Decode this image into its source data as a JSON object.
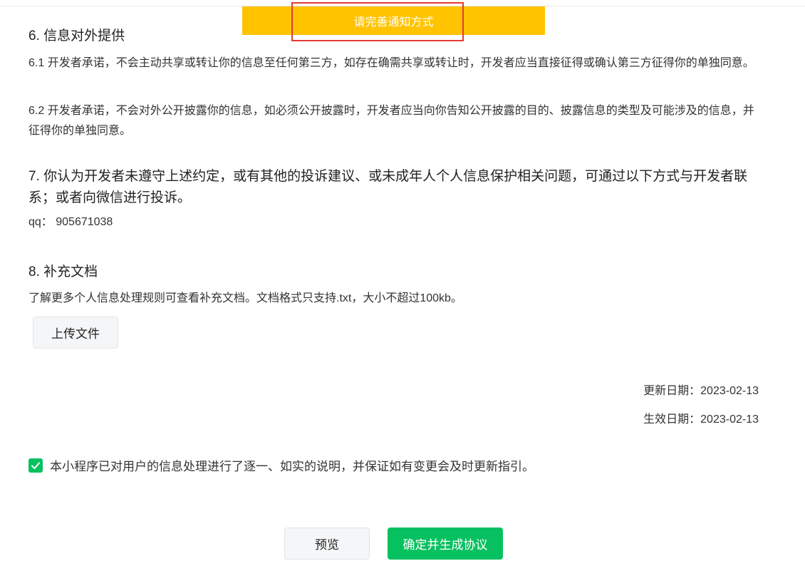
{
  "toast": {
    "text": "请完善通知方式"
  },
  "section6": {
    "title": "6.  信息对外提供",
    "p1": "6.1   开发者承诺，不会主动共享或转让你的信息至任何第三方，如存在确需共享或转让时，开发者应当直接征得或确认第三方征得你的单独同意。",
    "p2": "6.2   开发者承诺，不会对外公开披露你的信息，如必须公开披露时，开发者应当向你告知公开披露的目的、披露信息的类型及可能涉及的信息，并征得你的单独同意。"
  },
  "section7": {
    "title": "7.  你认为开发者未遵守上述约定，或有其他的投诉建议、或未成年人个人信息保护相关问题，可通过以下方式与开发者联系；或者向微信进行投诉。",
    "contact": "qq：  905671038"
  },
  "section8": {
    "title": "8.  补充文档",
    "desc": "了解更多个人信息处理规则可查看补充文档。文档格式只支持.txt，大小不超过100kb。",
    "upload_label": "上传文件"
  },
  "dates": {
    "updated": "更新日期：2023-02-13",
    "effective": "生效日期：2023-02-13"
  },
  "agreement": {
    "checked": true,
    "label": "本小程序已对用户的信息处理进行了逐一、如实的说明，并保证如有变更会及时更新指引。"
  },
  "actions": {
    "preview_label": "预览",
    "confirm_label": "确定并生成协议"
  },
  "colors": {
    "toast_bg": "#ffc300",
    "highlight_border": "#e53935",
    "primary_green": "#07c160"
  }
}
